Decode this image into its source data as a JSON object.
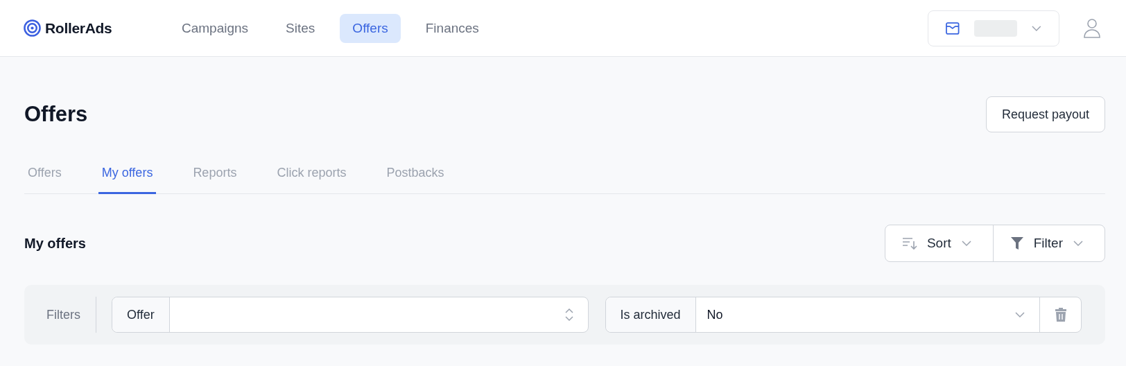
{
  "header": {
    "logo": "RollerAds",
    "nav": [
      {
        "label": "Campaigns",
        "selected": false
      },
      {
        "label": "Sites",
        "selected": false
      },
      {
        "label": "Offers",
        "selected": true
      },
      {
        "label": "Finances",
        "selected": false
      }
    ]
  },
  "page": {
    "title": "Offers",
    "action": "Request payout"
  },
  "tabs": [
    {
      "label": "Offers",
      "selected": false
    },
    {
      "label": "My offers",
      "selected": true
    },
    {
      "label": "Reports",
      "selected": false
    },
    {
      "label": "Click reports",
      "selected": false
    },
    {
      "label": "Postbacks",
      "selected": false
    }
  ],
  "section": {
    "title": "My offers",
    "sort": "Sort",
    "filter": "Filter"
  },
  "filters": {
    "label": "Filters",
    "items": [
      {
        "kind": "combobox",
        "label": "Offer"
      },
      {
        "kind": "select",
        "label": "Is archived",
        "value": "No"
      }
    ]
  }
}
